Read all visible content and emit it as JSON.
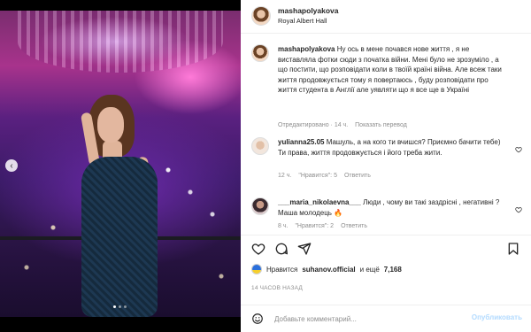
{
  "post": {
    "username": "mashapolyakova",
    "location": "Royal Albert Hall"
  },
  "caption": {
    "username": "mashapolyakova",
    "text": "Ну ось в мене почався нове життя , я не виставляла фотки сюди з початка війни. Мені було не зрозуміло , а що постити, що розповідати коли в твоїй країні війна. Але всеж таки життя продовжується тому я повертаюсь , буду розповідати про життя студента в Англії але уявляти що я все ще в Україні",
    "meta_edited": "Отредактировано · 14 ч.",
    "meta_translate": "Показать перевод"
  },
  "comments": [
    {
      "username": "yulianna25.05",
      "text": "Машуль, а на кого ти вчишся? Приємно бачити тебе) Ти права, життя продовжується і його треба жити.",
      "time": "12 ч.",
      "likes": "\"Нравится\": 5",
      "reply": "Ответить"
    },
    {
      "username": "___maria_nikolaevna___",
      "text": "Люди , чому ви такі заздрісні , негативні ? Маша молодець 🔥",
      "time": "8 ч.",
      "likes": "\"Нравится\": 2",
      "reply": "Ответить"
    }
  ],
  "likes_line": {
    "prefix": "Нравится",
    "user": "suhanov.official",
    "suffix": "и ещё",
    "count": "7,168"
  },
  "timestamp": "14 ЧАСОВ НАЗАД",
  "add_comment": {
    "placeholder": "Добавьте комментарий...",
    "post_label": "Опубликовать"
  },
  "icons": [
    "chevron-left-icon",
    "heart-icon",
    "comment-icon",
    "share-icon",
    "bookmark-icon",
    "emoji-icon"
  ],
  "colors": {
    "accent": "#0095f6",
    "post_disabled": "#b3dbff",
    "flag_blue": "#2a6fdb",
    "flag_yellow": "#f6cf2a"
  }
}
